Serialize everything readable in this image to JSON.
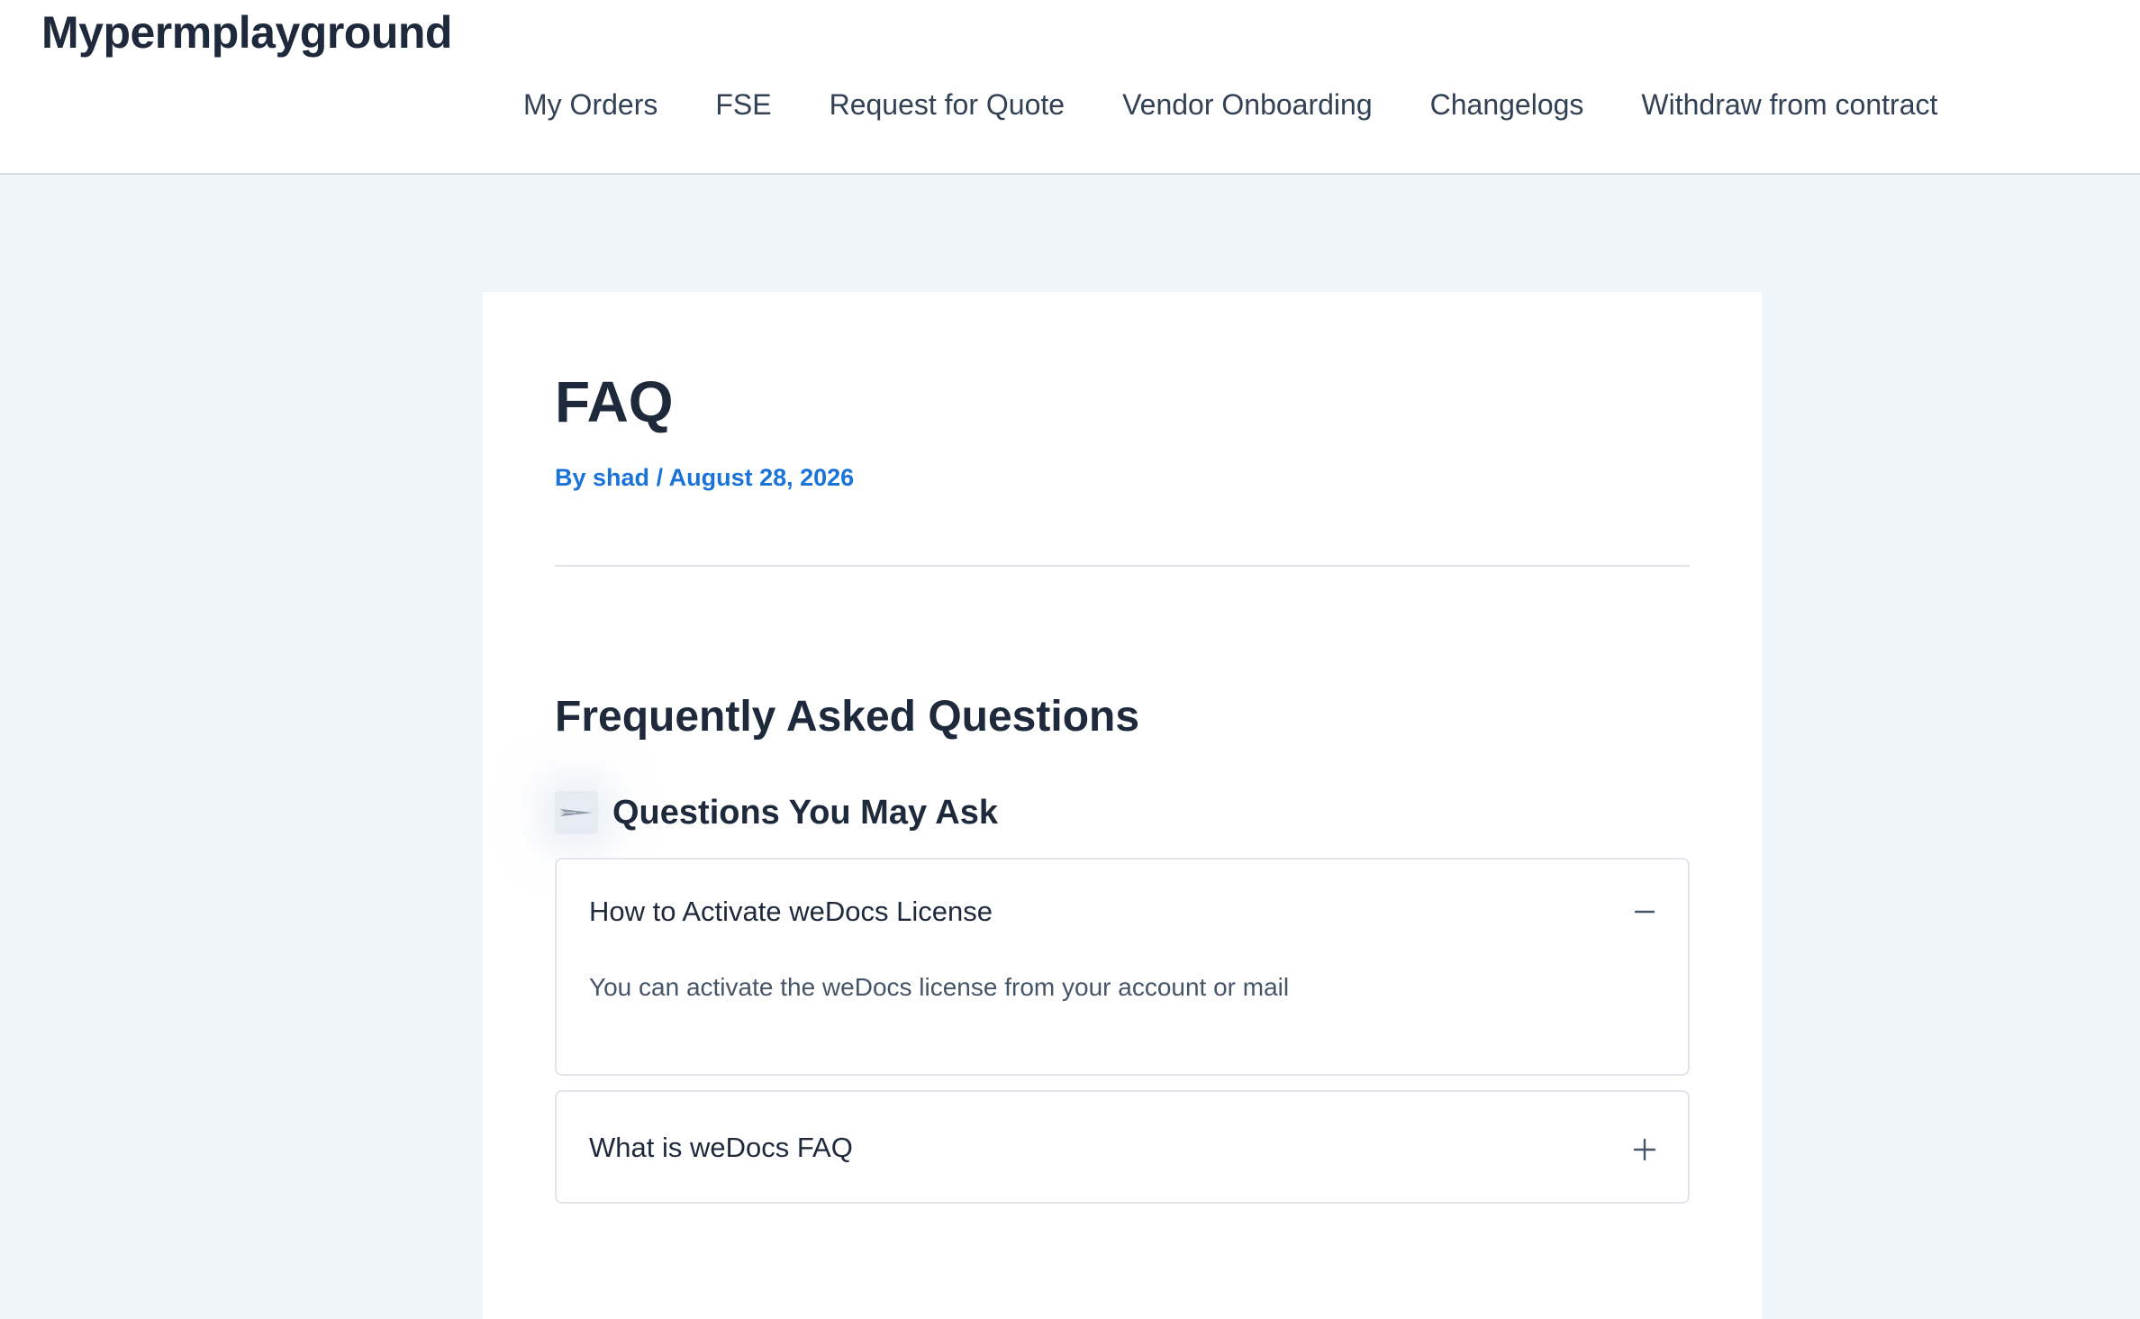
{
  "header": {
    "site_title": "Mypermplayground",
    "nav": [
      {
        "label": "My Orders"
      },
      {
        "label": "FSE"
      },
      {
        "label": "Request for Quote"
      },
      {
        "label": "Vendor Onboarding"
      },
      {
        "label": "Changelogs"
      },
      {
        "label": "Withdraw from contract"
      }
    ]
  },
  "article": {
    "title": "FAQ",
    "meta": {
      "by": "By",
      "author": "shad",
      "separator": "/",
      "date": "August 28, 2026"
    }
  },
  "faq": {
    "heading": "Frequently Asked Questions",
    "group": {
      "title": "Questions You May Ask",
      "icon": "paper-plane-icon"
    },
    "items": [
      {
        "question": "How to Activate weDocs License",
        "answer": "You can activate the weDocs license from your account or mail",
        "expanded": true,
        "toggle_icon": "minus-icon"
      },
      {
        "question": "What is weDocs FAQ",
        "expanded": false,
        "toggle_icon": "plus-icon"
      }
    ]
  },
  "colors": {
    "page_background": "#f0f5fa",
    "card_background": "#ffffff",
    "heading_text": "#1e293b",
    "meta_link": "#1a73d9",
    "border": "#e2e6eb"
  }
}
